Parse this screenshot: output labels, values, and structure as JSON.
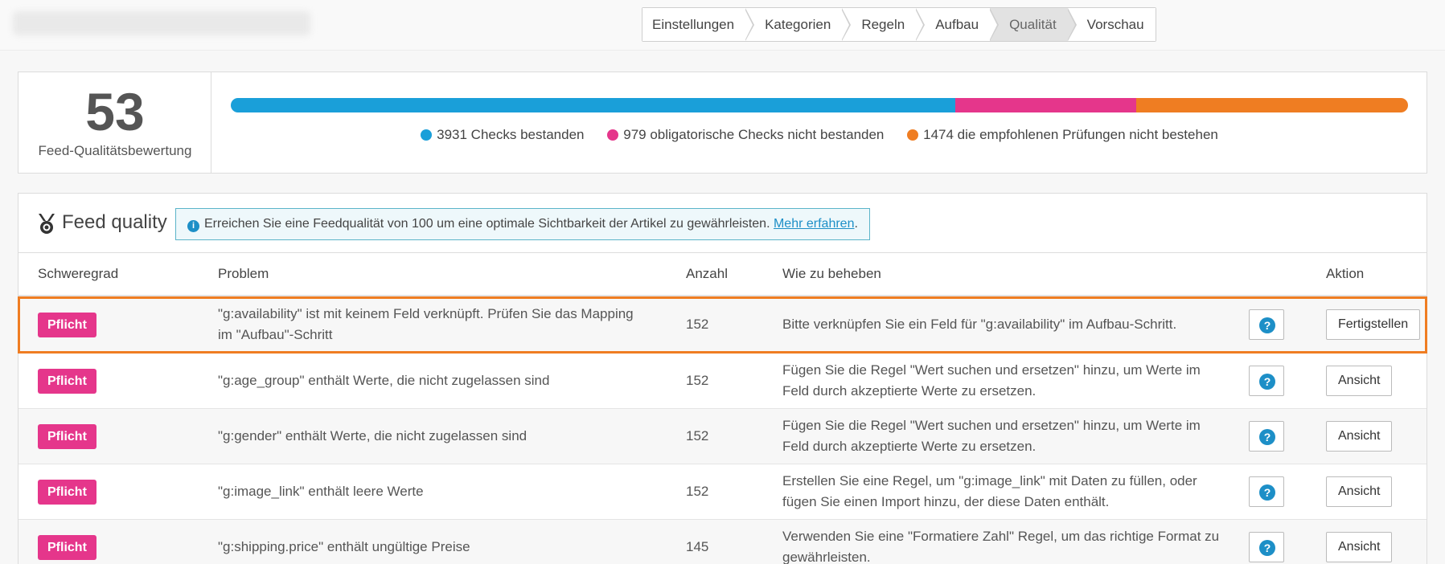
{
  "stepper": {
    "steps": [
      "Einstellungen",
      "Kategorien",
      "Regeln",
      "Aufbau",
      "Qualität",
      "Vorschau"
    ],
    "active_index": 4
  },
  "score": {
    "value": "53",
    "label": "Feed-Qualitätsbewertung"
  },
  "checks": {
    "passed": {
      "count": 3931,
      "text": "3931 Checks bestanden",
      "color": "#1a9fd9"
    },
    "mandatory_failed": {
      "count": 979,
      "text": "979 obligatorische Checks nicht bestanden",
      "color": "#e5368b"
    },
    "recommended_failed": {
      "count": 1474,
      "text": "1474 die empfohlenen Prüfungen nicht bestehen",
      "color": "#ef7d22"
    }
  },
  "quality": {
    "title": "Feed quality",
    "icon": "medal-icon",
    "info_text": "Erreichen Sie eine Feedqualität von 100 um eine optimale Sichtbarkeit der Artikel zu gewährleisten.",
    "info_link": "Mehr erfahren",
    "info_suffix": "."
  },
  "table": {
    "headers": {
      "severity": "Schweregrad",
      "problem": "Problem",
      "count": "Anzahl",
      "fix": "Wie zu beheben",
      "action": "Aktion"
    },
    "rows": [
      {
        "severity": "Pflicht",
        "problem_1": "\"g:availability\" ist mit keinem Feld verknüpft. Prüfen Sie das Mapping",
        "problem_2": "im \"Aufbau\"-Schritt",
        "count": "152",
        "fix_1": "Bitte verknüpfen Sie ein Feld für \"g:availability\" im Aufbau-Schritt.",
        "fix_2": "",
        "action": "Fertigstellen"
      },
      {
        "severity": "Pflicht",
        "problem_1": "\"g:age_group\" enthält Werte, die nicht zugelassen sind",
        "problem_2": "",
        "count": "152",
        "fix_1": "Fügen Sie die Regel \"Wert suchen und ersetzen\" hinzu, um Werte im",
        "fix_2": "Feld durch akzeptierte Werte zu ersetzen.",
        "action": "Ansicht"
      },
      {
        "severity": "Pflicht",
        "problem_1": "\"g:gender\" enthält Werte, die nicht zugelassen sind",
        "problem_2": "",
        "count": "152",
        "fix_1": "Fügen Sie die Regel \"Wert suchen und ersetzen\" hinzu, um Werte im",
        "fix_2": "Feld durch akzeptierte Werte zu ersetzen.",
        "action": "Ansicht"
      },
      {
        "severity": "Pflicht",
        "problem_1": "\"g:image_link\" enthält leere Werte",
        "problem_2": "",
        "count": "152",
        "fix_1": "Erstellen Sie eine Regel, um \"g:image_link\" mit Daten zu füllen, oder",
        "fix_2": "fügen Sie einen Import hinzu, der diese Daten enthält.",
        "action": "Ansicht"
      },
      {
        "severity": "Pflicht",
        "problem_1": "\"g:shipping.price\" enthält ungültige Preise",
        "problem_2": "",
        "count": "145",
        "fix_1": "Verwenden Sie eine \"Formatiere Zahl\" Regel, um das richtige Format zu",
        "fix_2": "gewährleisten.",
        "action": "Ansicht"
      }
    ]
  }
}
